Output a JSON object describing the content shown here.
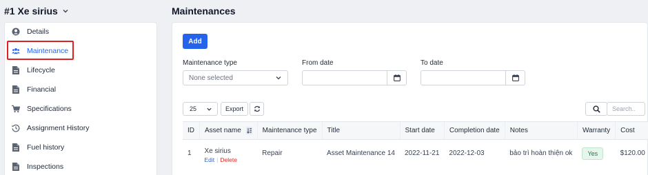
{
  "asset": {
    "title": "#1 Xe sirius"
  },
  "sidebar": {
    "items": [
      {
        "label": "Details",
        "icon": "user-circle-icon",
        "active": false
      },
      {
        "label": "Maintenance",
        "icon": "users-icon",
        "active": true
      },
      {
        "label": "Lifecycle",
        "icon": "document-icon",
        "active": false
      },
      {
        "label": "Financial",
        "icon": "document-icon",
        "active": false
      },
      {
        "label": "Specifications",
        "icon": "cart-icon",
        "active": false
      },
      {
        "label": "Assignment History",
        "icon": "history-icon",
        "active": false
      },
      {
        "label": "Fuel history",
        "icon": "document-icon",
        "active": false
      },
      {
        "label": "Inspections",
        "icon": "document-icon",
        "active": false
      }
    ]
  },
  "main": {
    "title": "Maintenances",
    "add_label": "Add",
    "filters": {
      "type_label": "Maintenance type",
      "type_placeholder": "None selected",
      "from_label": "From date",
      "to_label": "To date"
    },
    "toolbar": {
      "page_size": "25",
      "export_label": "Export",
      "search_placeholder": "Search.."
    },
    "table": {
      "columns": [
        "ID",
        "Asset name",
        "Maintenance type",
        "Title",
        "Start date",
        "Completion date",
        "Notes",
        "Warranty",
        "Cost"
      ],
      "rows": [
        {
          "id": "1",
          "asset_name": "Xe sirius",
          "edit": "Edit",
          "delete": "Delete",
          "maintenance_type": "Repair",
          "title": "Asset Maintenance 14",
          "start_date": "2022-11-21",
          "completion_date": "2022-12-03",
          "notes": "bảo trì hoàn thiện ok",
          "warranty": "Yes",
          "cost": "$120.00"
        }
      ]
    }
  },
  "colors": {
    "accent": "#2563eb",
    "highlight": "#e0201f",
    "success": "#15803d",
    "danger": "#dc2626"
  }
}
